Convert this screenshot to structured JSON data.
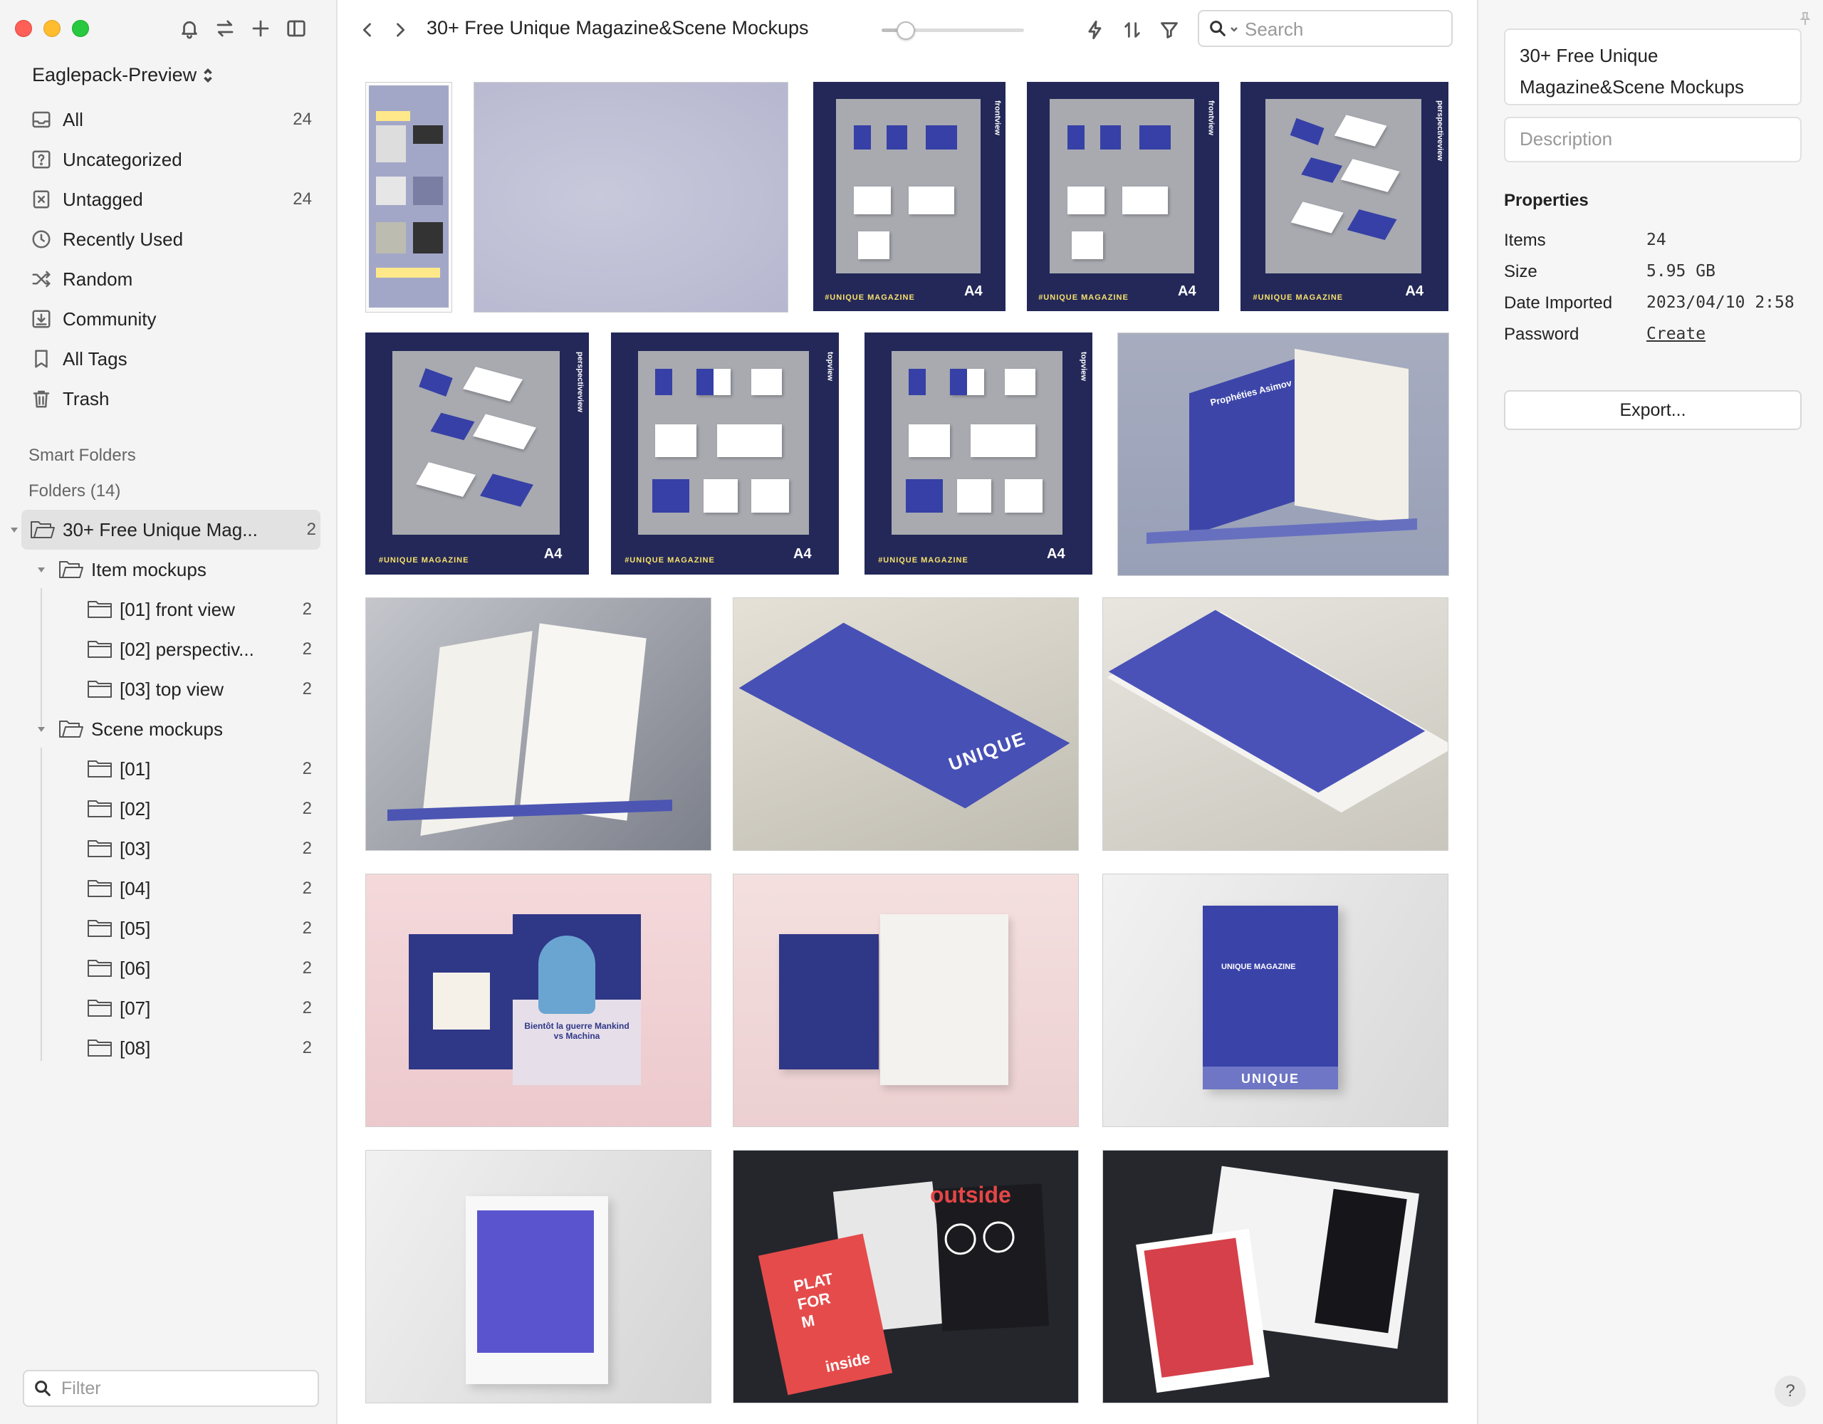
{
  "sidebar": {
    "library_name": "Eaglepack-Preview",
    "nav": [
      {
        "icon": "inbox-icon",
        "label": "All",
        "count": "24"
      },
      {
        "icon": "question-icon",
        "label": "Uncategorized",
        "count": ""
      },
      {
        "icon": "untag-icon",
        "label": "Untagged",
        "count": "24"
      },
      {
        "icon": "clock-icon",
        "label": "Recently Used",
        "count": ""
      },
      {
        "icon": "shuffle-icon",
        "label": "Random",
        "count": ""
      },
      {
        "icon": "download-icon",
        "label": "Community",
        "count": ""
      },
      {
        "icon": "bookmark-icon",
        "label": "All Tags",
        "count": ""
      },
      {
        "icon": "trash-icon",
        "label": "Trash",
        "count": ""
      }
    ],
    "smart_folders_label": "Smart Folders",
    "folders_label": "Folders (14)",
    "folders": [
      {
        "label": "30+ Free Unique Mag...",
        "count": "2"
      },
      {
        "label": "Item mockups",
        "count": ""
      },
      {
        "label": "[01] front view",
        "count": "2"
      },
      {
        "label": "[02] perspectiv...",
        "count": "2"
      },
      {
        "label": "[03] top view",
        "count": "2"
      },
      {
        "label": "Scene mockups",
        "count": ""
      },
      {
        "label": "[01]",
        "count": "2"
      },
      {
        "label": "[02]",
        "count": "2"
      },
      {
        "label": "[03]",
        "count": "2"
      },
      {
        "label": "[04]",
        "count": "2"
      },
      {
        "label": "[05]",
        "count": "2"
      },
      {
        "label": "[06]",
        "count": "2"
      },
      {
        "label": "[07]",
        "count": "2"
      },
      {
        "label": "[08]",
        "count": "2"
      }
    ],
    "filter_placeholder": "Filter"
  },
  "toolbar": {
    "title": "30+ Free Unique Magazine&Scene Mockups",
    "zoom_level": 0.12,
    "search_placeholder": "Search"
  },
  "grid": {
    "mag_footer": "#UNIQUE MAGAZINE",
    "a4_label": "A4",
    "views": [
      "frontview",
      "perspectiveview",
      "topview"
    ],
    "scene_texts": {
      "book_title_1": "Prophéties Asimov",
      "mag_unique": "UNIQUE",
      "mag_magazine": "UNIQUE MAGAZINE",
      "poster": "Bientôt la guerre Mankind vs Machina",
      "outside": "outside",
      "platform": "PLATFORM",
      "inside": "inside"
    }
  },
  "inspector": {
    "name": "30+ Free Unique Magazine&Scene Mockups",
    "description_placeholder": "Description",
    "properties_title": "Properties",
    "properties": [
      {
        "key": "Items",
        "value": "24"
      },
      {
        "key": "Size",
        "value": "5.95 GB"
      },
      {
        "key": "Date Imported",
        "value": "2023/04/10 2:58"
      },
      {
        "key": "Password",
        "value": "Create"
      }
    ],
    "export_label": "Export...",
    "help_label": "?"
  },
  "colors": {
    "navy": "#232858",
    "accent_blue": "#3640a6",
    "selection": "#e2e2e2"
  }
}
